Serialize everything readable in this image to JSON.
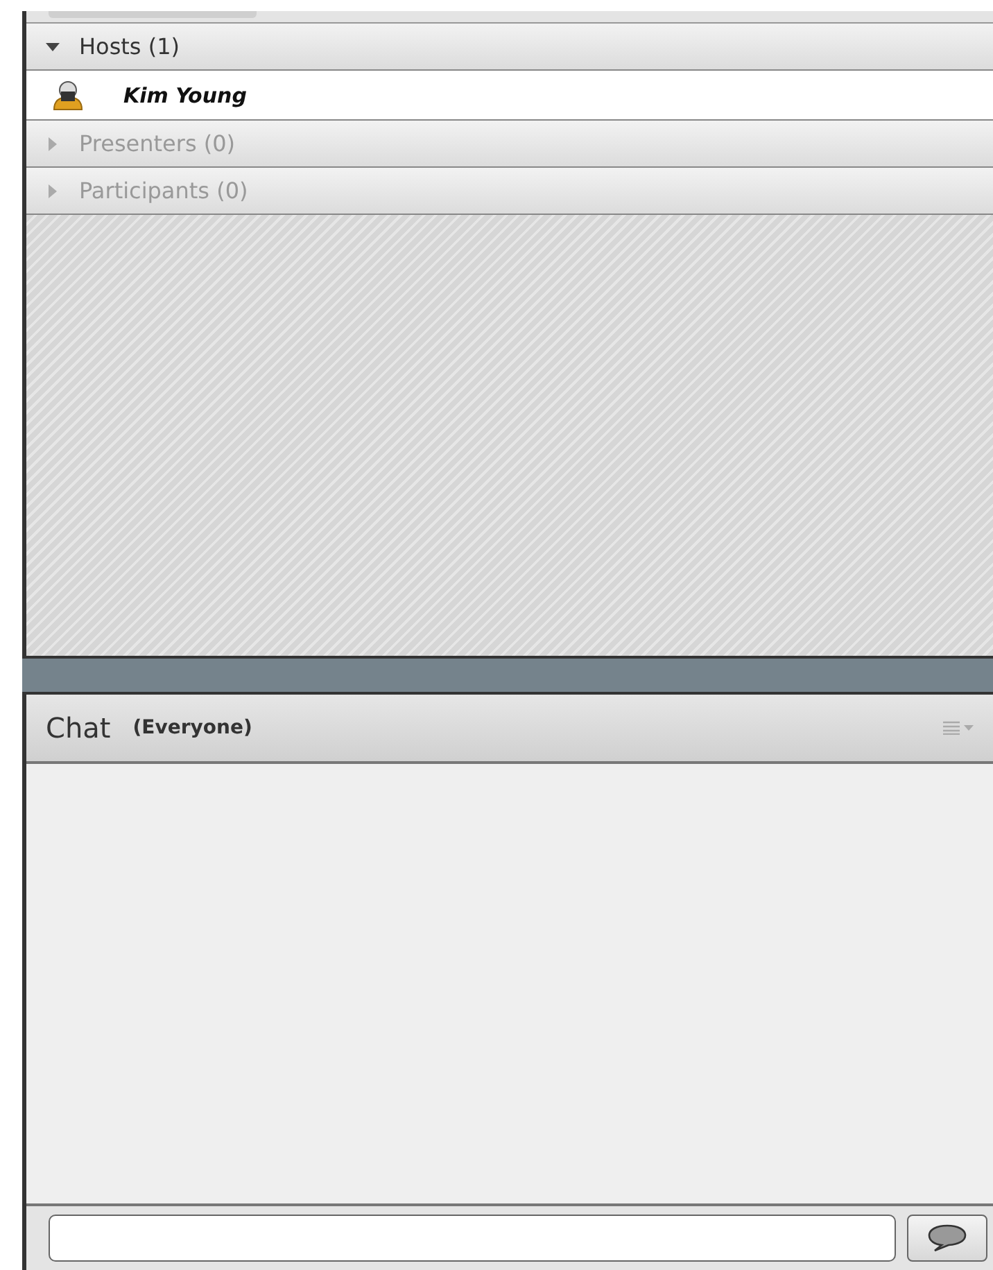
{
  "attendees": {
    "groups": [
      {
        "label": "Hosts (1)",
        "expanded": true,
        "children": [
          {
            "name": "Kim Young"
          }
        ]
      },
      {
        "label": "Presenters (0)",
        "expanded": false
      },
      {
        "label": "Participants (0)",
        "expanded": false
      }
    ]
  },
  "chat": {
    "title": "Chat",
    "audience": "(Everyone)"
  }
}
